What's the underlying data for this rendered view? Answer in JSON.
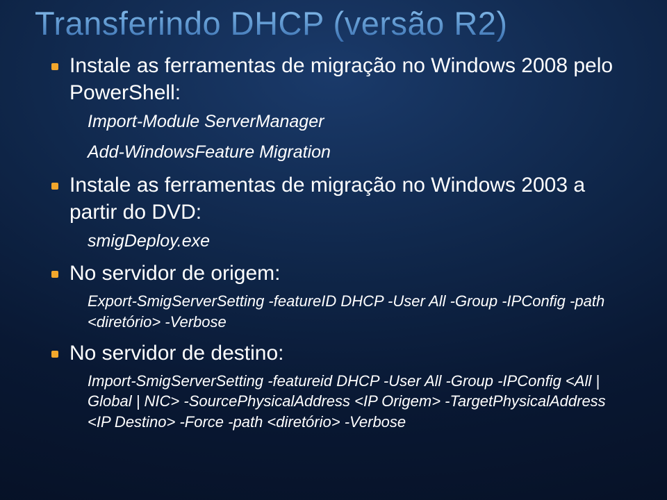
{
  "title": "Transferindo DHCP (versão R2)",
  "bullets": [
    {
      "text": "Instale as ferramentas de migração no Windows 2008 pelo PowerShell:",
      "sub": [
        "Import-Module ServerManager",
        "Add-WindowsFeature Migration"
      ]
    },
    {
      "text": "Instale as ferramentas de migração no Windows 2003 a partir do DVD:",
      "sub": [
        "smigDeploy.exe"
      ]
    },
    {
      "text": "No servidor de origem:",
      "code": "Export-SmigServerSetting -featureID DHCP -User All -Group -IPConfig -path <diretório> -Verbose"
    },
    {
      "text": "No servidor de destino:",
      "code": "Import-SmigServerSetting -featureid DHCP -User All -Group -IPConfig <All | Global | NIC> -SourcePhysicalAddress <IP Origem> -TargetPhysicalAddress <IP Destino> -Force -path <diretório> -Verbose"
    }
  ]
}
